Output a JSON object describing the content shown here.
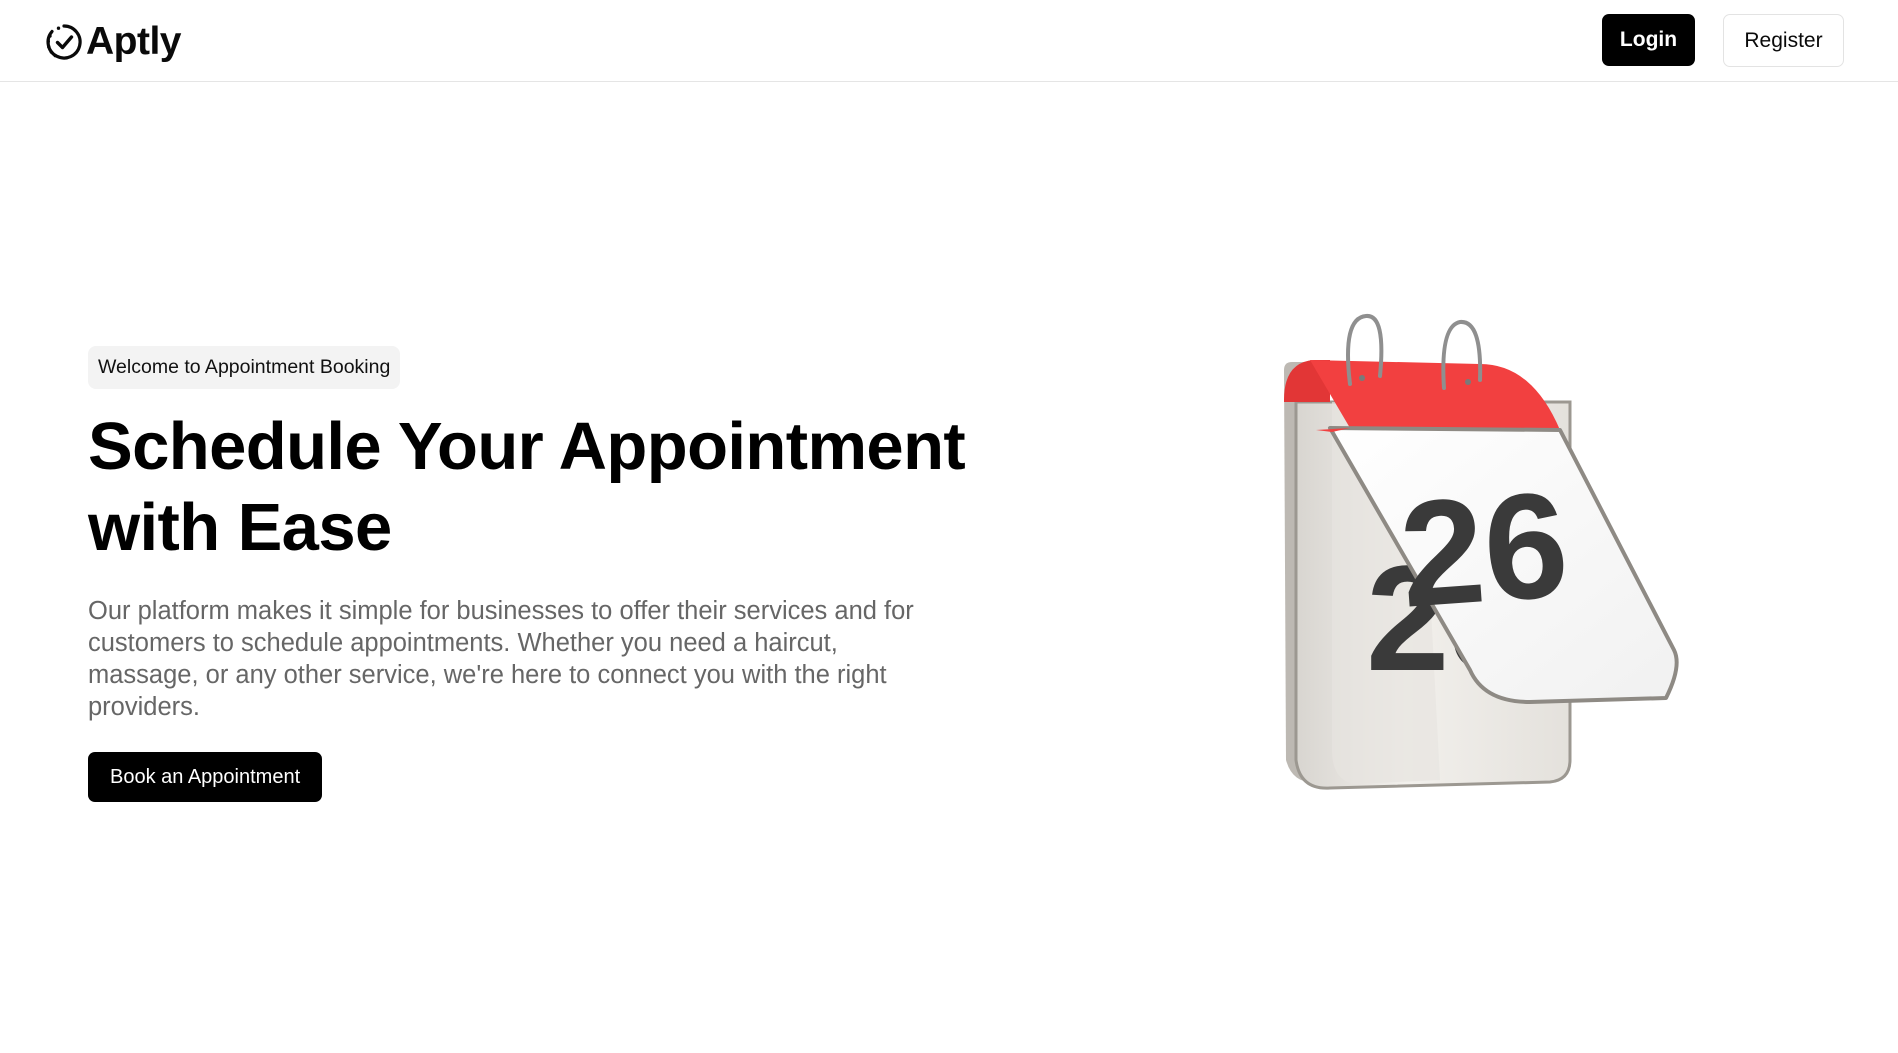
{
  "header": {
    "brand_name": "Aptly",
    "brand_icon": "circle-check-icon",
    "login_label": "Login",
    "register_label": "Register"
  },
  "hero": {
    "badge": "Welcome to Appointment Booking",
    "title_line1": "Schedule Your Appointment",
    "title_line2": "with Ease",
    "description": "Our platform makes it simple for businesses to offer their services and for customers to schedule appointments. Whether you need a haircut, massage, or any other service, we're here to connect you with the right providers.",
    "cta_label": "Book an Appointment",
    "illustration": {
      "icon": "calendar-icon",
      "front_day": "26",
      "back_day": "25",
      "accent_color": "#f24040"
    }
  },
  "colors": {
    "primary": "#000000",
    "background": "#ffffff",
    "muted_text": "#666666",
    "badge_bg": "#f3f3f3"
  }
}
